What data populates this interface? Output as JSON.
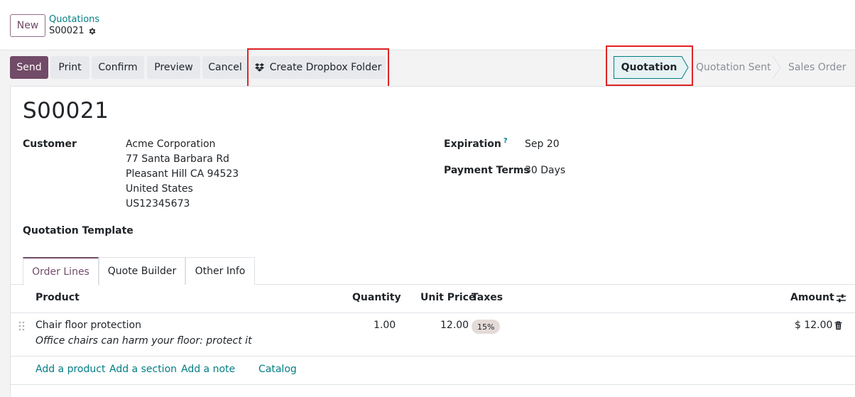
{
  "breadcrumb": {
    "new_label": "New",
    "parent": "Quotations",
    "current": "S00021"
  },
  "actions": {
    "send": "Send",
    "print": "Print",
    "confirm": "Confirm",
    "preview": "Preview",
    "cancel": "Cancel",
    "dropbox": "Create Dropbox Folder"
  },
  "status": {
    "steps": [
      "Quotation",
      "Quotation Sent",
      "Sales Order"
    ],
    "active": "Quotation"
  },
  "form": {
    "title": "S00021",
    "customer_label": "Customer",
    "customer_lines": [
      "Acme Corporation",
      "77 Santa Barbara Rd",
      "Pleasant Hill CA 94523",
      "United States",
      "US12345673"
    ],
    "expiration_label": "Expiration",
    "expiration_help": "?",
    "expiration_value": "Sep 20",
    "payment_terms_label": "Payment Terms",
    "payment_terms_value": "30 Days",
    "template_label": "Quotation Template"
  },
  "tabs": [
    "Order Lines",
    "Quote Builder",
    "Other Info"
  ],
  "order_lines": {
    "columns": {
      "product": "Product",
      "quantity": "Quantity",
      "unit_price": "Unit Price",
      "taxes": "Taxes",
      "amount": "Amount"
    },
    "rows": [
      {
        "product": "Chair floor protection",
        "description": "Office chairs can harm your floor: protect it",
        "quantity": "1.00",
        "unit_price": "12.00",
        "tax": "15%",
        "amount": "$ 12.00"
      }
    ],
    "add_links": {
      "product": "Add a product",
      "section": "Add a section",
      "note": "Add a note",
      "catalog": "Catalog"
    }
  },
  "colors": {
    "brand": "#714b67",
    "link": "#017e84",
    "highlight": "#e02424"
  }
}
